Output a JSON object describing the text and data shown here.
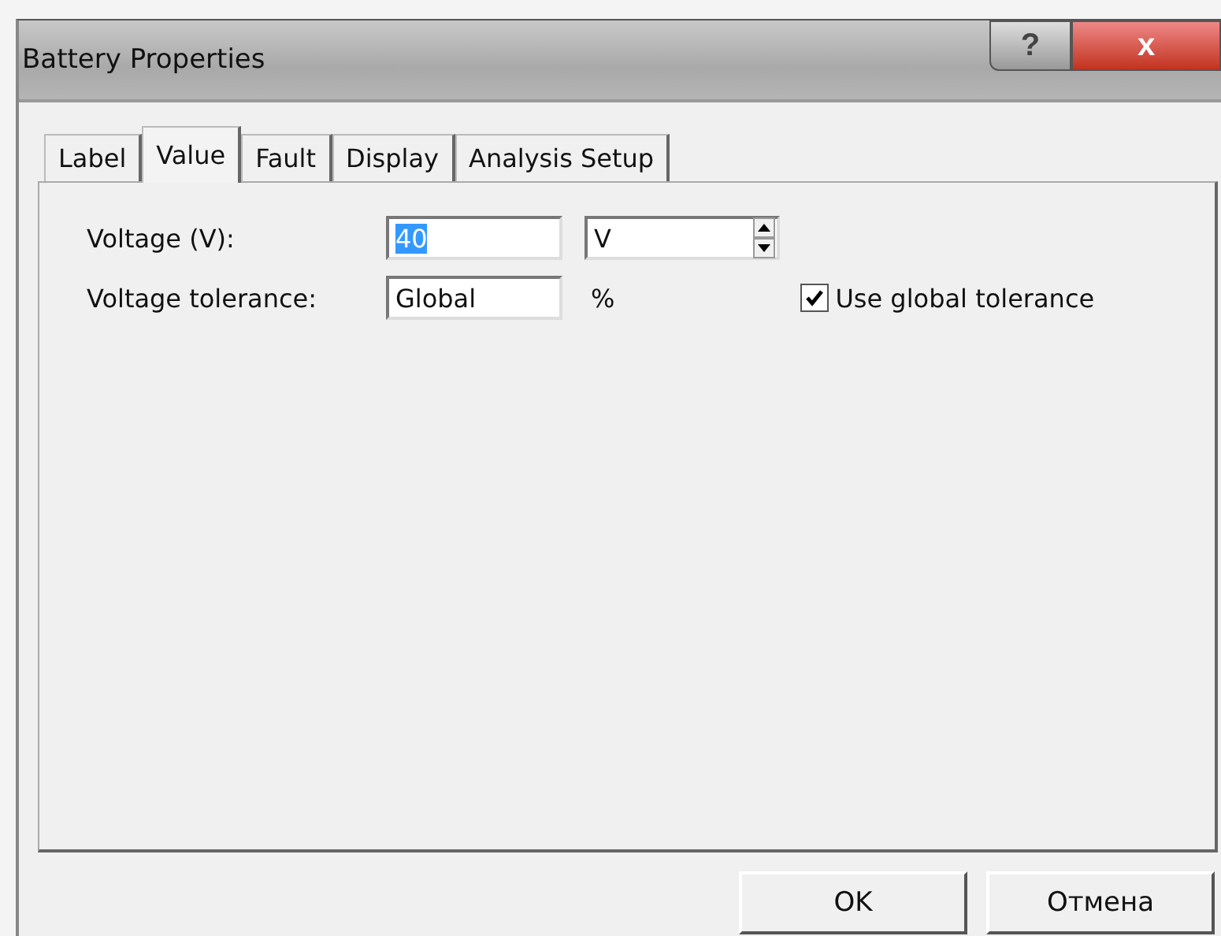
{
  "window": {
    "title": "Battery Properties",
    "help": "?",
    "close": "x"
  },
  "tabs": [
    {
      "label": "Label",
      "selected": false
    },
    {
      "label": "Value",
      "selected": true
    },
    {
      "label": "Fault",
      "selected": false
    },
    {
      "label": "Display",
      "selected": false
    },
    {
      "label": "Analysis Setup",
      "selected": false
    }
  ],
  "voltage": {
    "label": "Voltage (V):",
    "value": "40",
    "value_selected": true,
    "unit": "V"
  },
  "tolerance": {
    "label": "Voltage tolerance:",
    "value": "Global",
    "unit": "%"
  },
  "use_global_tolerance": {
    "label": "Use global tolerance",
    "checked": true
  },
  "buttons": [
    "OK",
    "Отмена"
  ]
}
